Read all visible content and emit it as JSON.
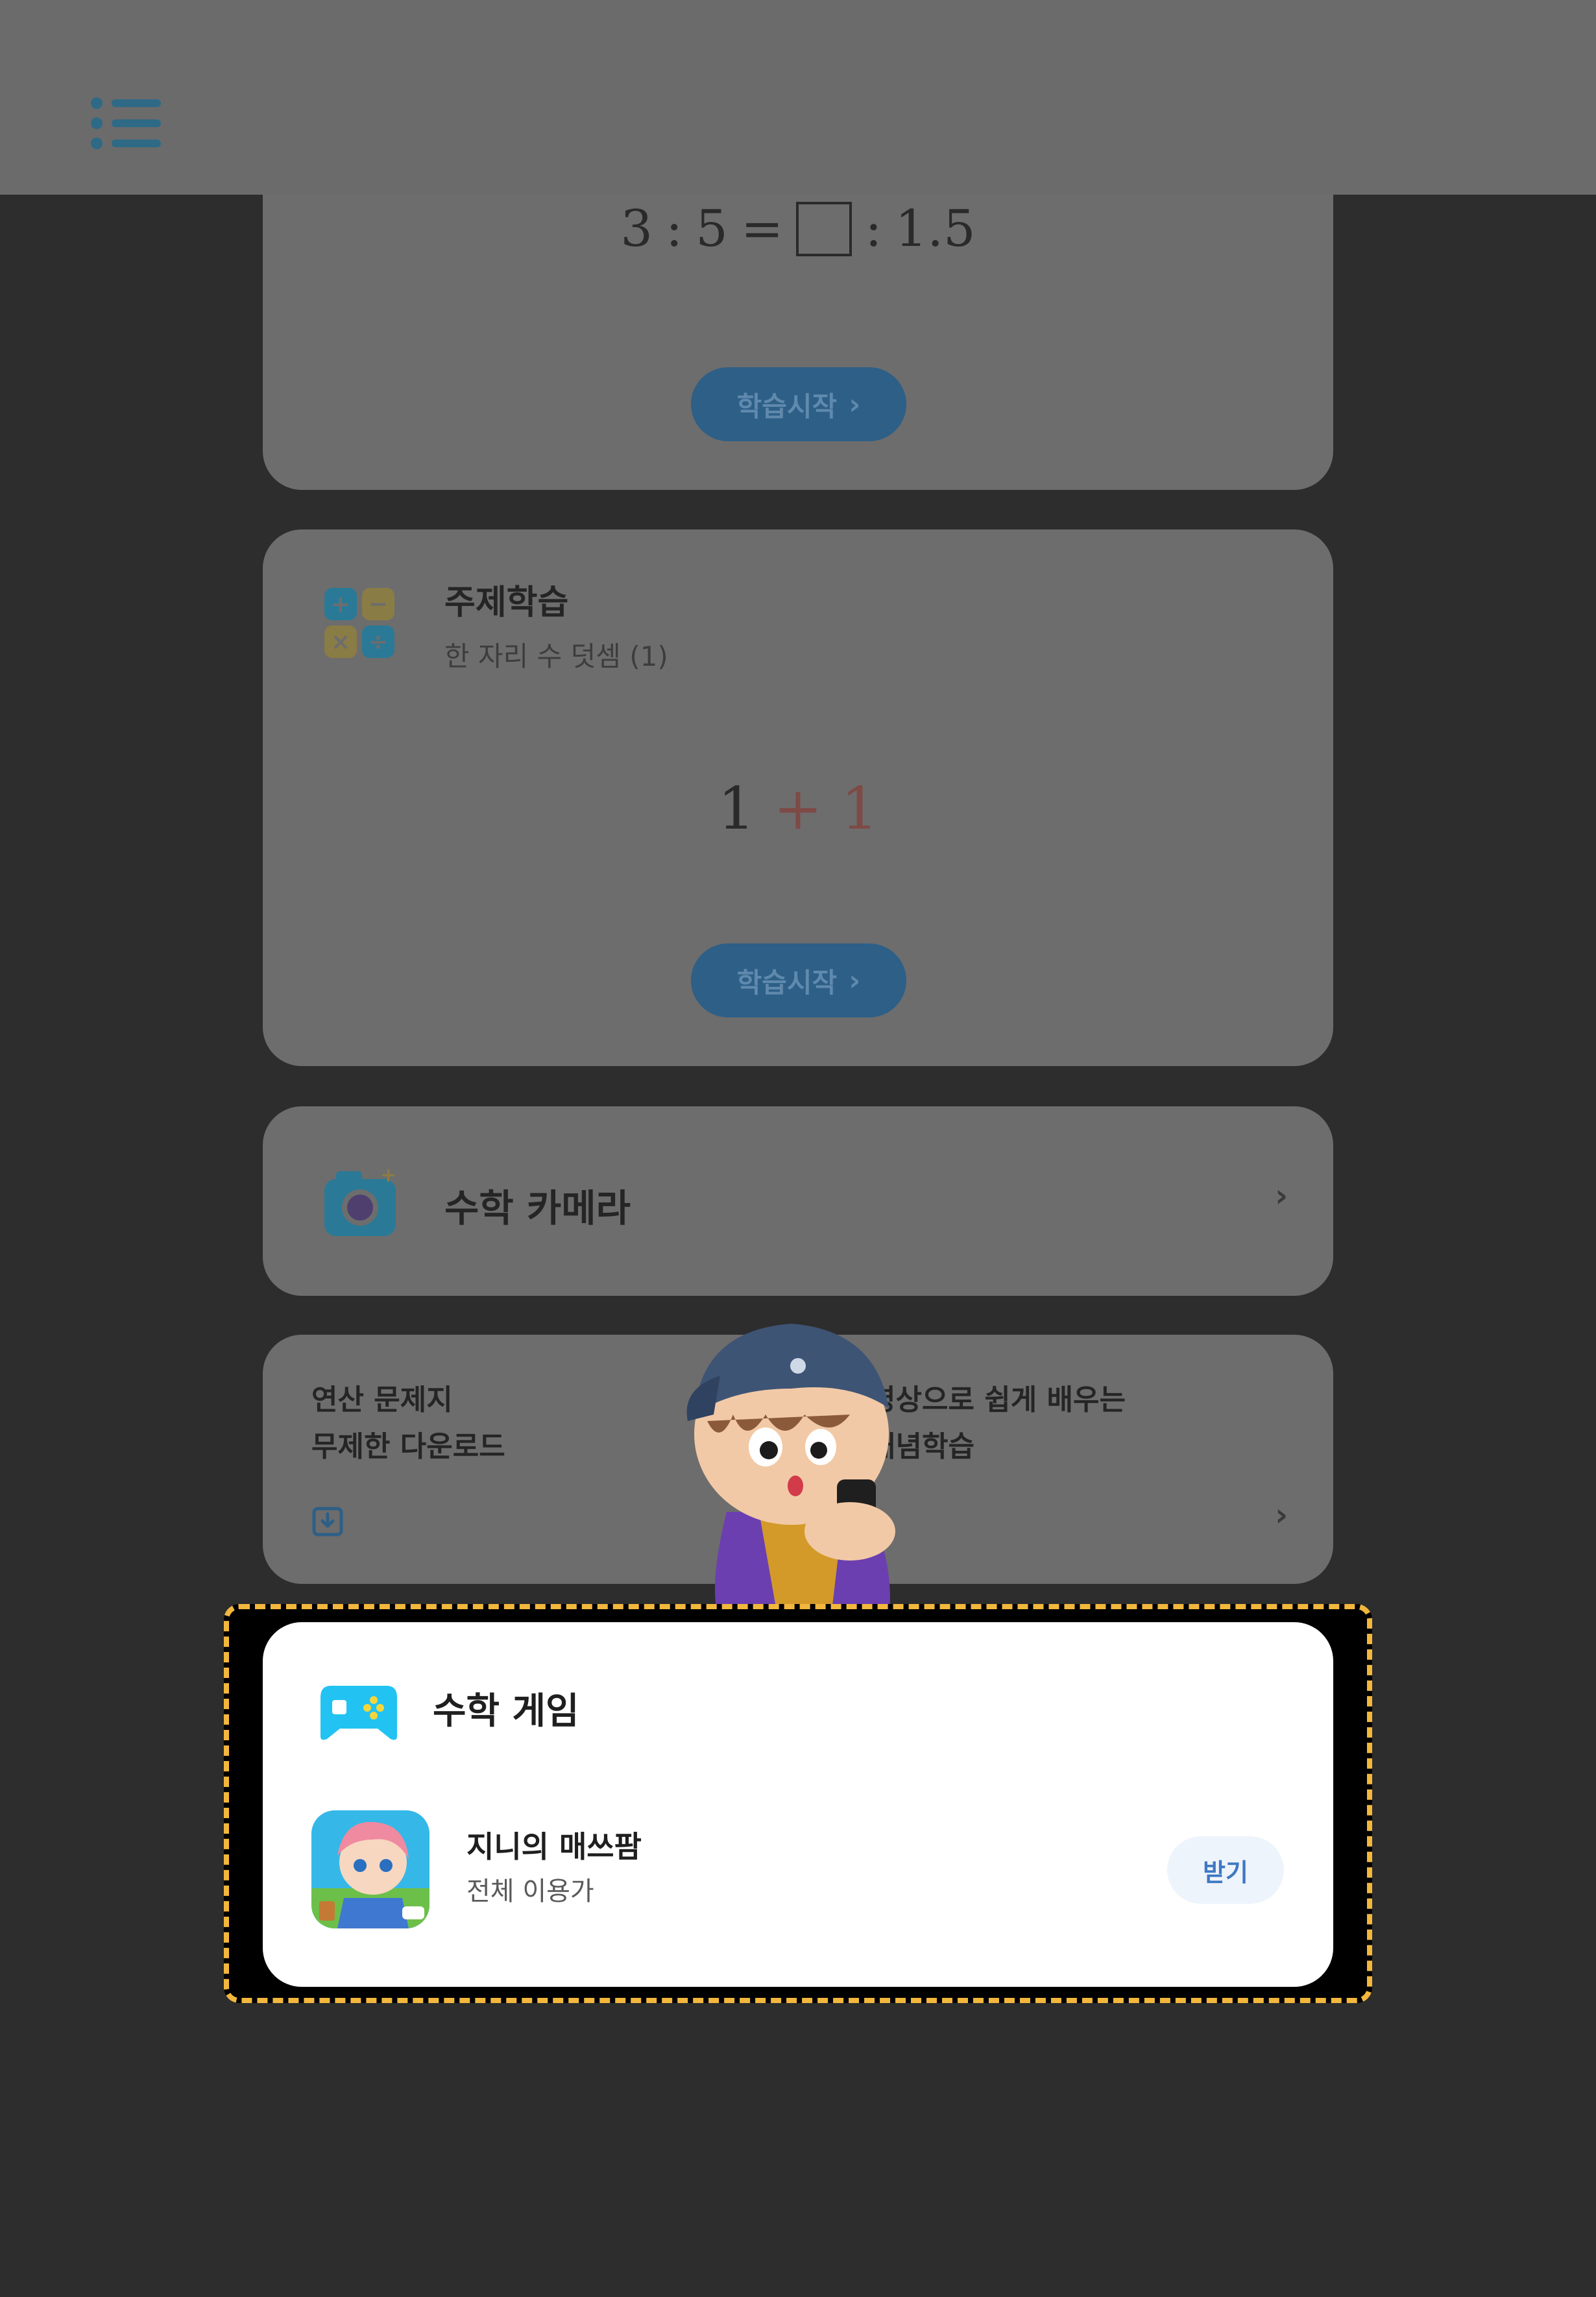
{
  "header": {
    "menu_icon": "list-menu-icon"
  },
  "problem_card": {
    "expression": {
      "a": "3",
      "sep1": ":",
      "b": "5",
      "eq": "=",
      "sep2": ":",
      "c": "1.5"
    },
    "start_button": "학습시작"
  },
  "topic_card": {
    "icon": "calculator-ops-icon",
    "title": "주제학습",
    "subtitle": "한 자리 수 덧셈 (1)",
    "expression": {
      "left": "1",
      "op": "+",
      "right": "1"
    },
    "start_button": "학습시작"
  },
  "camera_card": {
    "icon": "camera-icon",
    "label": "수학 카메라"
  },
  "promo_card": {
    "left_line1": "연산 문제지",
    "left_line2": "무제한 다운로드",
    "right_line1": "영상으로 쉽게 배우는",
    "right_line2": "개념학습",
    "left_icon": "download-icon"
  },
  "game_card": {
    "icon": "gamepad-icon",
    "title": "수학 게임",
    "app": {
      "name": "지니의 매쓰팜",
      "rating": "전체 이용가",
      "get_button": "받기"
    }
  },
  "colors": {
    "accent_blue": "#2d5f87",
    "frame_dash": "#f2b73c",
    "game_cyan": "#22c3f2"
  }
}
